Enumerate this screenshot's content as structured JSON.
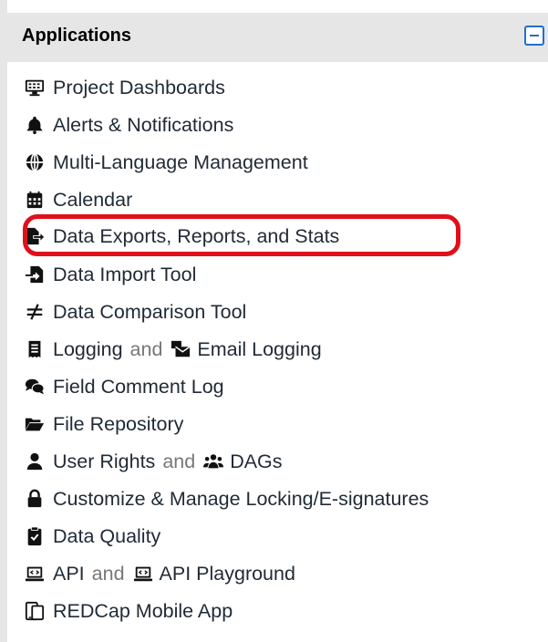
{
  "panel": {
    "title": "Applications"
  },
  "items": [
    {
      "label": "Project Dashboards",
      "icon": "dashboard-icon"
    },
    {
      "label": "Alerts & Notifications",
      "icon": "bell-icon"
    },
    {
      "label": "Multi-Language Management",
      "icon": "globe-icon"
    },
    {
      "label": "Calendar",
      "icon": "calendar-icon"
    },
    {
      "label": "Data Exports, Reports, and Stats",
      "icon": "file-export-icon",
      "highlighted": true
    },
    {
      "label": "Data Import Tool",
      "icon": "file-import-icon"
    },
    {
      "label": "Data Comparison Tool",
      "icon": "not-equal-icon"
    },
    {
      "label": "Logging",
      "icon": "receipt-icon",
      "conj": "and",
      "label2": "Email Logging",
      "icon2": "mail-bulk-icon"
    },
    {
      "label": "Field Comment Log",
      "icon": "comments-icon"
    },
    {
      "label": "File Repository",
      "icon": "folder-open-icon"
    },
    {
      "label": "User Rights",
      "icon": "user-icon",
      "conj": "and",
      "label2": "DAGs",
      "icon2": "users-icon"
    },
    {
      "label": "Customize & Manage Locking/E-signatures",
      "icon": "lock-icon"
    },
    {
      "label": "Data Quality",
      "icon": "clipboard-check-icon"
    },
    {
      "label": "API",
      "icon": "laptop-code-icon",
      "conj": "and",
      "label2": "API Playground",
      "icon2": "laptop-code-icon"
    },
    {
      "label": "REDCap Mobile App",
      "icon": "tablet-icon"
    }
  ],
  "colors": {
    "highlight": "#e0101a",
    "header_bg": "#e6e6e6",
    "text": "#1f2a36"
  }
}
